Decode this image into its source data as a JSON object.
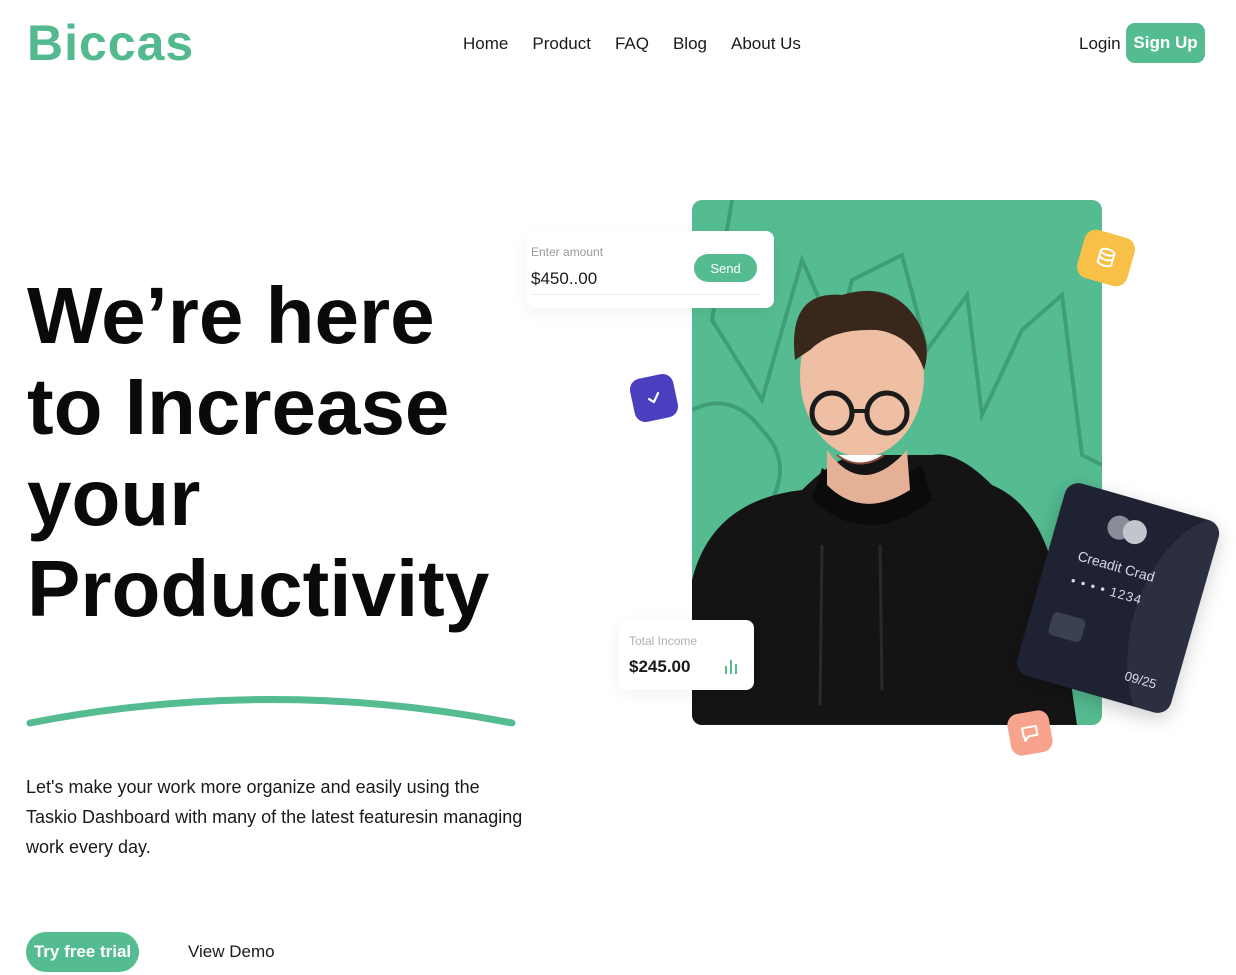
{
  "brand": {
    "logo": "Biccas",
    "accent": "#55bc91"
  },
  "nav": {
    "items": [
      {
        "label": "Home"
      },
      {
        "label": "Product"
      },
      {
        "label": "FAQ"
      },
      {
        "label": "Blog"
      },
      {
        "label": "About Us"
      }
    ],
    "login": "Login",
    "signup": "Sign Up"
  },
  "hero": {
    "headline_lines": [
      "We’re here",
      "to Increase",
      "your",
      "Productivity"
    ],
    "description": "Let's make your work more organize and easily using the Taskio Dashboard with many of the latest featuresin managing work every day.",
    "primary_cta": "Try free trial",
    "secondary_cta": "View Demo"
  },
  "widgets": {
    "amount": {
      "label": "Enter amount",
      "value": "$450..00",
      "button": "Send"
    },
    "income": {
      "label": "Total Income",
      "value": "$245.00",
      "icon": "bar-chart-icon"
    },
    "credit_card": {
      "name": "Creadit Crad",
      "number": "• • • •   1234",
      "expiry": "09/25"
    },
    "badges": [
      {
        "icon": "checkmark-icon",
        "color": "#4b3fc0"
      },
      {
        "icon": "database-icon",
        "color": "#f9c047"
      },
      {
        "icon": "chat-icon",
        "color": "#f7a38e"
      }
    ]
  }
}
